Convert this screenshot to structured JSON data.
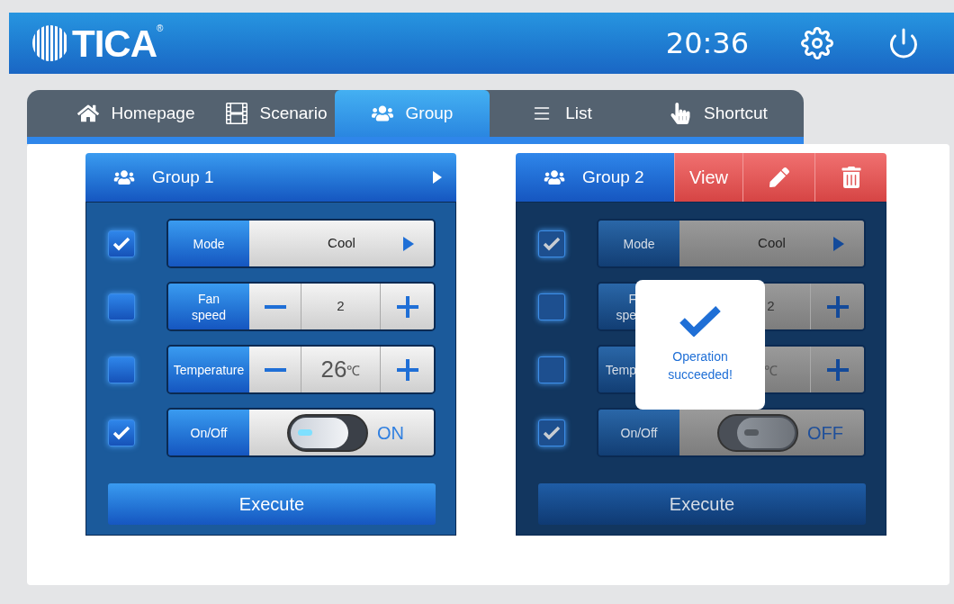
{
  "header": {
    "logo": "TICA",
    "registered": "®",
    "time": "20:36"
  },
  "tabs": [
    {
      "label": "Homepage",
      "selected": false
    },
    {
      "label": "Scenario",
      "selected": false
    },
    {
      "label": "Group",
      "selected": true
    },
    {
      "label": "List",
      "selected": false
    },
    {
      "label": "Shortcut",
      "selected": false
    }
  ],
  "groups": [
    {
      "name": "Group 1",
      "dimmed": false,
      "menu_open": false,
      "rows": [
        {
          "kind": "select",
          "checked": true,
          "label": "Mode",
          "value": "Cool"
        },
        {
          "kind": "stepper",
          "checked": false,
          "label": "Fan\nspeed",
          "value": "2",
          "large": false
        },
        {
          "kind": "stepper",
          "checked": false,
          "label": "Temperature",
          "value": "26",
          "unit": "℃",
          "large": true
        },
        {
          "kind": "switch",
          "checked": true,
          "label": "On/Off",
          "on": true,
          "state_label": "ON"
        }
      ],
      "execute": "Execute"
    },
    {
      "name": "Group 2",
      "dimmed": true,
      "menu_open": true,
      "actions": [
        {
          "kind": "text",
          "label": "View"
        },
        {
          "kind": "edit"
        },
        {
          "kind": "delete"
        }
      ],
      "rows": [
        {
          "kind": "select",
          "checked": true,
          "label": "Mode",
          "value": "Cool"
        },
        {
          "kind": "stepper",
          "checked": false,
          "label": "F\nspe",
          "clipped": true,
          "value": "2",
          "large": false
        },
        {
          "kind": "stepper",
          "checked": false,
          "label": "Temp",
          "clipped": true,
          "unit": "℃",
          "large": true
        },
        {
          "kind": "switch",
          "checked": true,
          "label": "On/Off",
          "on": false,
          "state_label": "OFF"
        }
      ],
      "execute": "Execute",
      "toast": {
        "message": "Operation succeeded!"
      }
    }
  ]
}
